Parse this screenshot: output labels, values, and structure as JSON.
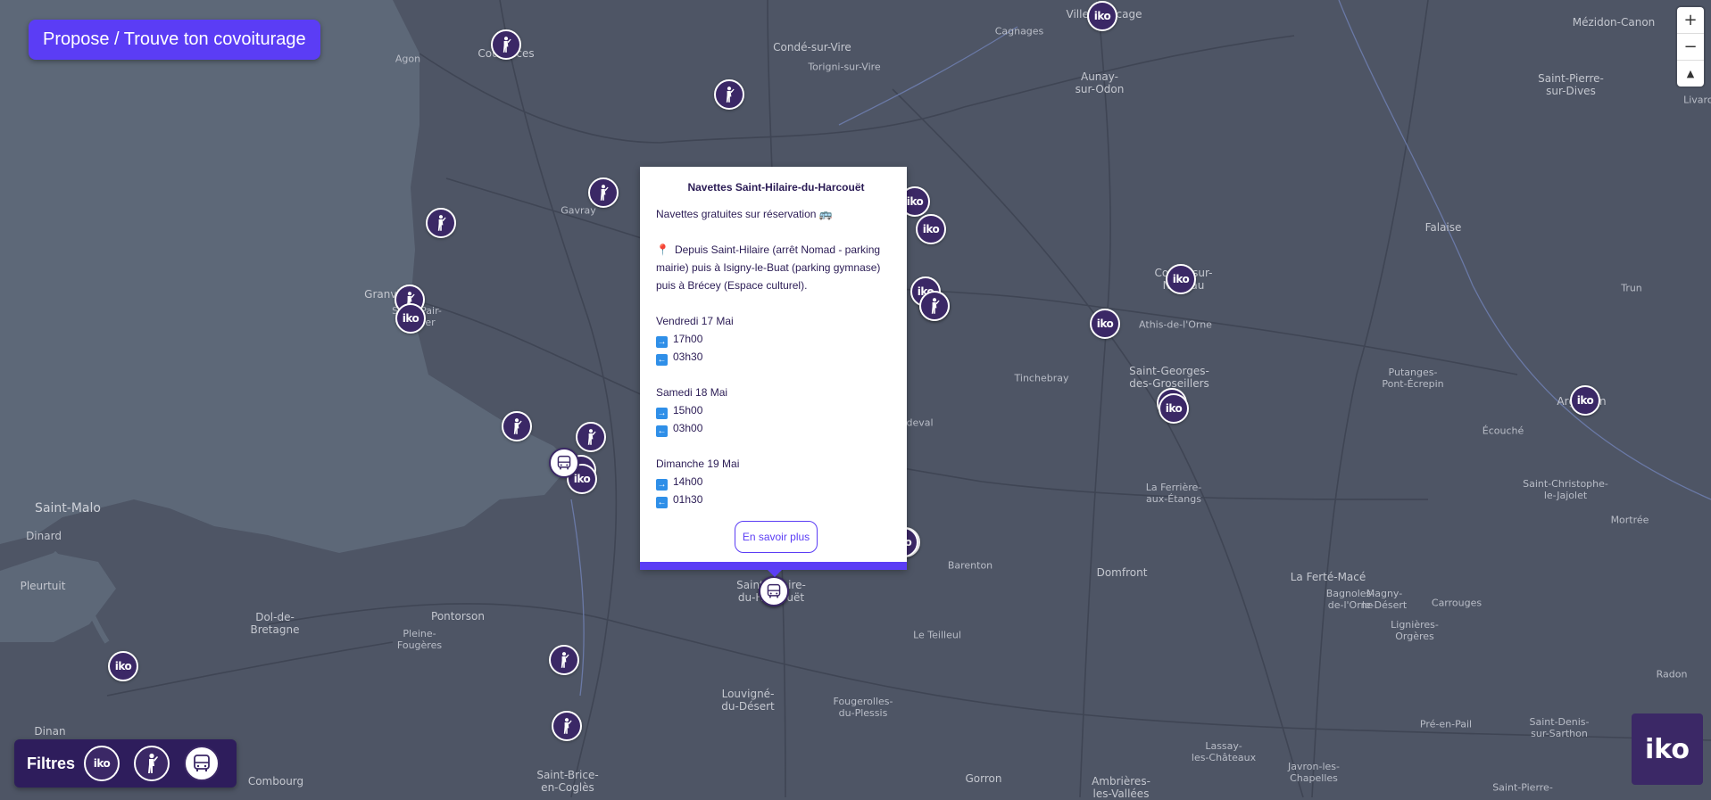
{
  "propose_button": "Propose / Trouve ton covoiturage",
  "zoom": {
    "in": "+",
    "out": "−",
    "reset": "▲"
  },
  "places": [
    {
      "label": "Agon",
      "class": ""
    },
    {
      "label": "Coutances",
      "class": "med"
    },
    {
      "label": "Condé-sur-Vire",
      "class": "med"
    },
    {
      "label": "Torigni-sur-Vire",
      "class": ""
    },
    {
      "label": "Villers-Bocage",
      "class": "med"
    },
    {
      "label": "Cagnages",
      "class": ""
    },
    {
      "label": "Aunay-\nsur-Odon",
      "class": "med"
    },
    {
      "label": "Mézidon-Canon",
      "class": "med"
    },
    {
      "label": "Saint-Pierre-\nsur-Dives",
      "class": "med"
    },
    {
      "label": "Gavray",
      "class": ""
    },
    {
      "label": "Granville",
      "class": "med"
    },
    {
      "label": "Saint-Pair-\nsur-Mer",
      "class": ""
    },
    {
      "label": "Falaise",
      "class": "med"
    },
    {
      "label": "Condé-sur-\nNoireau",
      "class": "med"
    },
    {
      "label": "Athis-de-l'Orne",
      "class": ""
    },
    {
      "label": "Trun",
      "class": ""
    },
    {
      "label": "Tinchebray",
      "class": ""
    },
    {
      "label": "Saint-Georges-\ndes-Groseillers",
      "class": "med"
    },
    {
      "label": "Putanges-\nPont-Écrepin",
      "class": ""
    },
    {
      "label": "Argentan",
      "class": "med"
    },
    {
      "label": "Sourdeval",
      "class": ""
    },
    {
      "label": "Écouché",
      "class": ""
    },
    {
      "label": "La Ferrière-\naux-Étangs",
      "class": ""
    },
    {
      "label": "Saint-Christophe-\nle-Jajolet",
      "class": ""
    },
    {
      "label": "Mortrée",
      "class": ""
    },
    {
      "label": "Saint-Malo",
      "class": "big"
    },
    {
      "label": "Dinard",
      "class": "med"
    },
    {
      "label": "Pleurtuit",
      "class": "med"
    },
    {
      "label": "Barenton",
      "class": ""
    },
    {
      "label": "Domfront",
      "class": "med"
    },
    {
      "label": "La Ferté-Macé",
      "class": "med"
    },
    {
      "label": "Magny-\nle-Désert",
      "class": ""
    },
    {
      "label": "Carrouges",
      "class": ""
    },
    {
      "label": "Saint-Hilaire-\ndu-Harcouët",
      "class": "med"
    },
    {
      "label": "Dol-de-\nBretagne",
      "class": "med"
    },
    {
      "label": "Pontorson",
      "class": "med"
    },
    {
      "label": "Pleine-\nFougères",
      "class": ""
    },
    {
      "label": "Le Teilleul",
      "class": ""
    },
    {
      "label": "Bagnoles-\nde-l'Orne",
      "class": ""
    },
    {
      "label": "Lignières-\nOrgères",
      "class": ""
    },
    {
      "label": "Radon",
      "class": ""
    },
    {
      "label": "Louvigné-\ndu-Désert",
      "class": "med"
    },
    {
      "label": "Fougerolles-\ndu-Plessis",
      "class": ""
    },
    {
      "label": "Pré-en-Pail",
      "class": ""
    },
    {
      "label": "Saint-Denis-\nsur-Sarthon",
      "class": ""
    },
    {
      "label": "Dinan",
      "class": "med"
    },
    {
      "label": "Lassay-\nles-Châteaux",
      "class": ""
    },
    {
      "label": "Combourg",
      "class": "med"
    },
    {
      "label": "Saint-Brice-\nen-Coglès",
      "class": "med"
    },
    {
      "label": "Gorron",
      "class": "med"
    },
    {
      "label": "Ambrières-\nles-Vallées",
      "class": "med"
    },
    {
      "label": "Javron-les-\nChapelles",
      "class": ""
    },
    {
      "label": "Saint-Pierre-",
      "class": ""
    },
    {
      "label": "Livarot",
      "class": ""
    }
  ],
  "markers": [
    {
      "type": "person"
    },
    {
      "type": "person"
    },
    {
      "type": "iko"
    },
    {
      "type": "person"
    },
    {
      "type": "person"
    },
    {
      "type": "iko"
    },
    {
      "type": "iko"
    },
    {
      "type": "person"
    },
    {
      "type": "iko"
    },
    {
      "type": "person"
    },
    {
      "type": "iko"
    },
    {
      "type": "iko"
    },
    {
      "type": "iko"
    },
    {
      "type": "iko"
    },
    {
      "type": "iko"
    },
    {
      "type": "person"
    },
    {
      "type": "person"
    },
    {
      "type": "iko"
    },
    {
      "type": "iko"
    },
    {
      "type": "bus"
    },
    {
      "type": "iko"
    },
    {
      "type": "bus"
    },
    {
      "type": "person"
    },
    {
      "type": "person"
    },
    {
      "type": "iko"
    },
    {
      "type": "person"
    },
    {
      "type": "person"
    },
    {
      "type": "iko"
    }
  ],
  "popup": {
    "title": "Navettes Saint-Hilaire-du-Harcouët",
    "lines": [
      {
        "kind": "text",
        "text": "Navettes gratuites sur réservation 🚌"
      },
      {
        "kind": "gap"
      },
      {
        "kind": "pin",
        "text": "Depuis Saint-Hilaire (arrêt Nomad - parking mairie) puis à Isigny-le-Buat (parking gymnase) puis à Brécey (Espace culturel)."
      },
      {
        "kind": "gap"
      },
      {
        "kind": "text",
        "text": "Vendredi 17 Mai"
      },
      {
        "kind": "out",
        "text": "17h00"
      },
      {
        "kind": "back",
        "text": "03h30"
      },
      {
        "kind": "gap"
      },
      {
        "kind": "text",
        "text": "Samedi 18 Mai"
      },
      {
        "kind": "out",
        "text": "15h00"
      },
      {
        "kind": "back",
        "text": "03h00"
      },
      {
        "kind": "gap"
      },
      {
        "kind": "text",
        "text": "Dimanche 19 Mai"
      },
      {
        "kind": "out",
        "text": "14h00"
      },
      {
        "kind": "back",
        "text": "01h30"
      }
    ],
    "more_label": "En savoir plus"
  },
  "filters": {
    "label": "Filtres"
  },
  "logo_text": "iko",
  "colors": {
    "accent": "#5b3df5",
    "marker": "#3b2866",
    "land": "#4e5565",
    "sea": "#5d6878"
  }
}
